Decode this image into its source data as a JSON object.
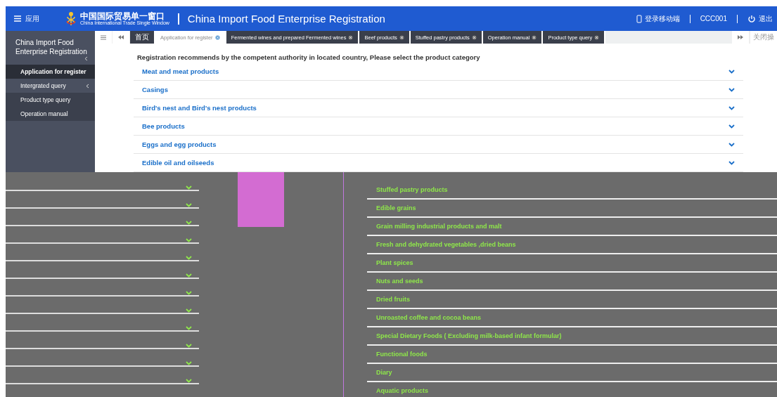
{
  "header": {
    "menu_label": "应用",
    "logo_cn": "中国国际贸易单一窗口",
    "logo_en": "China International Trade Single Window",
    "title": "China Import Food Enterprise Registration",
    "mobile": "登录移动端",
    "user": "CCC001",
    "logout": "退出"
  },
  "sidebar": {
    "title": "China Import Food Enterprise Registration",
    "items": [
      {
        "label": "Application for register",
        "selected": true,
        "submenu": false
      },
      {
        "label": "Intergrated query",
        "selected": false,
        "submenu": true
      },
      {
        "label": "Product type query",
        "selected": false,
        "submenu": false
      },
      {
        "label": "Operation manual",
        "selected": false,
        "submenu": false
      }
    ]
  },
  "tabs": [
    {
      "label": "首页",
      "selected": false,
      "closable": false
    },
    {
      "label": "Application for register",
      "selected": true,
      "closable": true
    },
    {
      "label": "Fermented wines and prepared Fermented wines",
      "selected": false,
      "closable": true
    },
    {
      "label": "Beef products",
      "selected": false,
      "closable": true
    },
    {
      "label": "Stuffed pastry products",
      "selected": false,
      "closable": true
    },
    {
      "label": "Operation manual",
      "selected": false,
      "closable": true
    },
    {
      "label": "Product type query",
      "selected": false,
      "closable": true
    }
  ],
  "close_ops": "关闭操",
  "content": {
    "heading": "Registration recommends by the competent authority in located country, Please select the product category",
    "categories": [
      "Meat and meat products",
      "Casings",
      "Bird's nest and Bird's nest products",
      "Bee products",
      "Eggs and egg products",
      "Edible oil and oilseeds"
    ],
    "glitched_categories": [
      "Stuffed pastry products",
      "Edible grains",
      "Grain milling industrial products and malt",
      "Fresh and dehydrated vegetables ,dried beans",
      "Plant spices",
      "Nuts and seeds",
      "Dried fruits",
      "Unroasted coffee and cocoa beans",
      "Special Dietary Foods ( Excluding milk-based infant formular)",
      "Functional foods",
      "Diary",
      "Aquatic products"
    ]
  }
}
